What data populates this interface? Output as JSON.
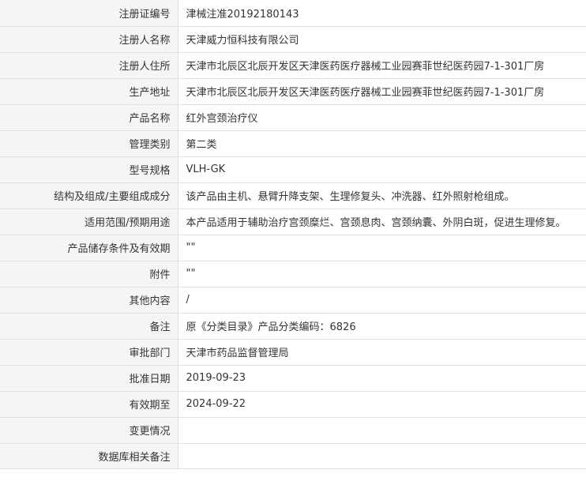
{
  "rows": [
    {
      "label": "注册证编号",
      "value": "津械注准20192180143"
    },
    {
      "label": "注册人名称",
      "value": "天津威力恒科技有限公司"
    },
    {
      "label": "注册人住所",
      "value": "天津市北辰区北辰开发区天津医药医疗器械工业园赛菲世纪医药园7-1-301厂房"
    },
    {
      "label": "生产地址",
      "value": "天津市北辰区北辰开发区天津医药医疗器械工业园赛菲世纪医药园7-1-301厂房"
    },
    {
      "label": "产品名称",
      "value": "红外宫颈治疗仪"
    },
    {
      "label": "管理类别",
      "value": "第二类"
    },
    {
      "label": "型号规格",
      "value": "VLH-GK"
    },
    {
      "label": "结构及组成/主要组成成分",
      "value": "该产品由主机、悬臂升降支架、生理修复头、冲洗器、红外照射枪组成。"
    },
    {
      "label": "适用范围/预期用途",
      "value": "本产品适用于辅助治疗宫颈糜烂、宫颈息肉、宫颈纳囊、外阴白斑，促进生理修复。"
    },
    {
      "label": "产品储存条件及有效期",
      "value": "\"\""
    },
    {
      "label": "附件",
      "value": "\"\""
    },
    {
      "label": "其他内容",
      "value": "/"
    },
    {
      "label": "备注",
      "value": "原《分类目录》产品分类编码：6826"
    },
    {
      "label": "审批部门",
      "value": "天津市药品监督管理局"
    },
    {
      "label": "批准日期",
      "value": "2019-09-23"
    },
    {
      "label": "有效期至",
      "value": "2024-09-22"
    },
    {
      "label": "变更情况",
      "value": ""
    },
    {
      "label": "数据库相关备注",
      "value": ""
    }
  ]
}
